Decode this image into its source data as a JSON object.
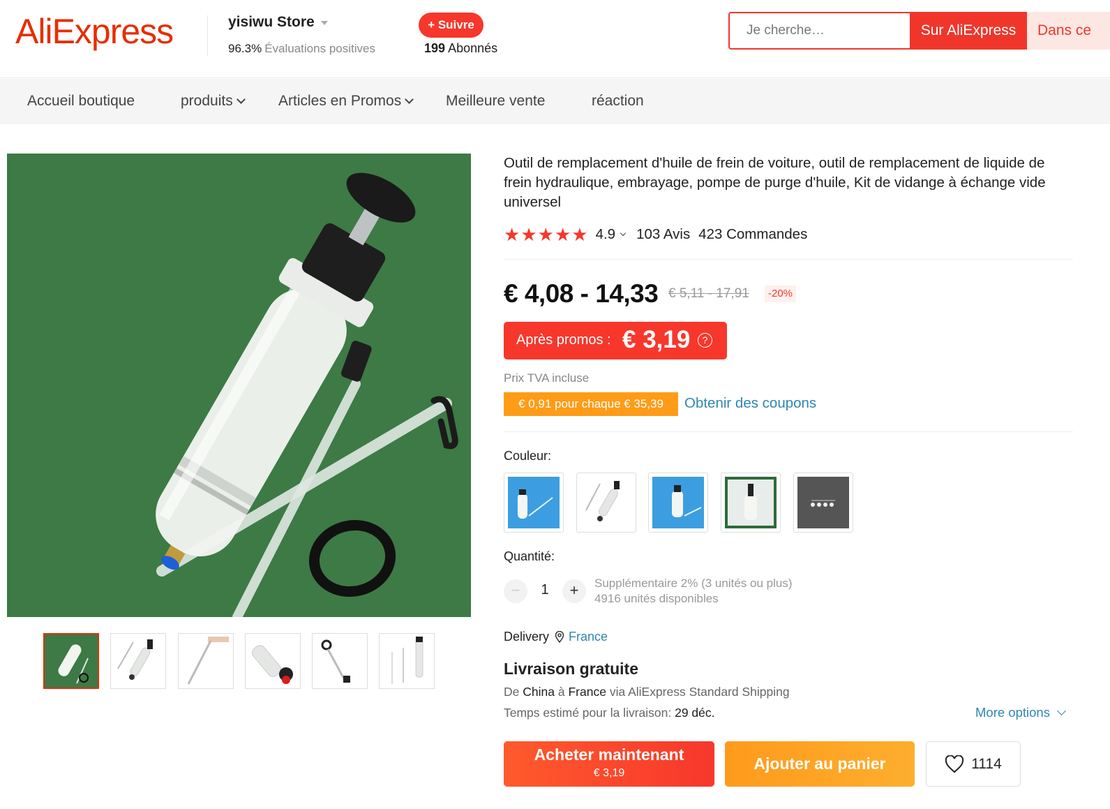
{
  "header": {
    "logo_text": "AliExpress",
    "store_name": "yisiwu Store",
    "positive_pct": "96.3%",
    "positive_label": "Évaluations positives",
    "follow_label": "+ Suivre",
    "followers_count": "199",
    "followers_label": "Abonnés",
    "search_placeholder": "Je cherche…",
    "search_ali_label": "Sur AliExpress",
    "search_store_label": "Dans ce"
  },
  "nav": {
    "items": [
      {
        "label": "Accueil boutique"
      },
      {
        "label": "produits",
        "dropdown": true
      },
      {
        "label": "Articles en Promos",
        "dropdown": true
      },
      {
        "label": "Meilleure vente"
      },
      {
        "label": "réaction"
      }
    ]
  },
  "gallery": {
    "thumb_count": 6,
    "active_thumb_index": 0
  },
  "product": {
    "title": "Outil de remplacement d'huile de frein de voiture, outil de remplacement de liquide de frein hydraulique, embrayage, pompe de purge d'huile, Kit de vidange à échange vide universel",
    "rating": "4.9",
    "stars": 5,
    "reviews": "103 Avis",
    "orders": "423 Commandes",
    "price_range": "€ 4,08 - 14,33",
    "original_price_range": "€ 5,11 - 17,91",
    "discount": "-20%",
    "promo_label": "Après promos :",
    "promo_price": "€ 3,19",
    "promo_help_icon": "?",
    "tva_label": "Prix TVA incluse",
    "coupon_badge": "€ 0,91 pour chaque € 35,39",
    "coupon_link": "Obtenir des coupons",
    "color_label": "Couleur:",
    "color_option_count": 5,
    "quantity_label": "Quantité:",
    "quantity_value": "1",
    "quantity_minus": "−",
    "quantity_plus": "+",
    "quantity_extra": "Supplémentaire 2% (3 unités ou plus)",
    "quantity_available": "4916 unités disponibles"
  },
  "delivery": {
    "label": "Delivery",
    "country": "France",
    "shipping_title": "Livraison gratuite",
    "route_de": "De",
    "route_from": "China",
    "route_a": "à",
    "route_to": "France",
    "route_via": "via AliExpress Standard Shipping",
    "time_label": "Temps estimé pour la livraison:",
    "time_value": "29 déc.",
    "more_options": "More options"
  },
  "actions": {
    "buy_label": "Acheter maintenant",
    "buy_price": "€ 3,19",
    "cart_label": "Ajouter au panier",
    "wish_count": "1114"
  },
  "colors": {
    "brand_red": "#e62e04",
    "accent_red": "#f7372c",
    "coupon_orange": "#fe9c18",
    "link_blue": "#2e86b3",
    "image_green": "#3d7a45"
  }
}
